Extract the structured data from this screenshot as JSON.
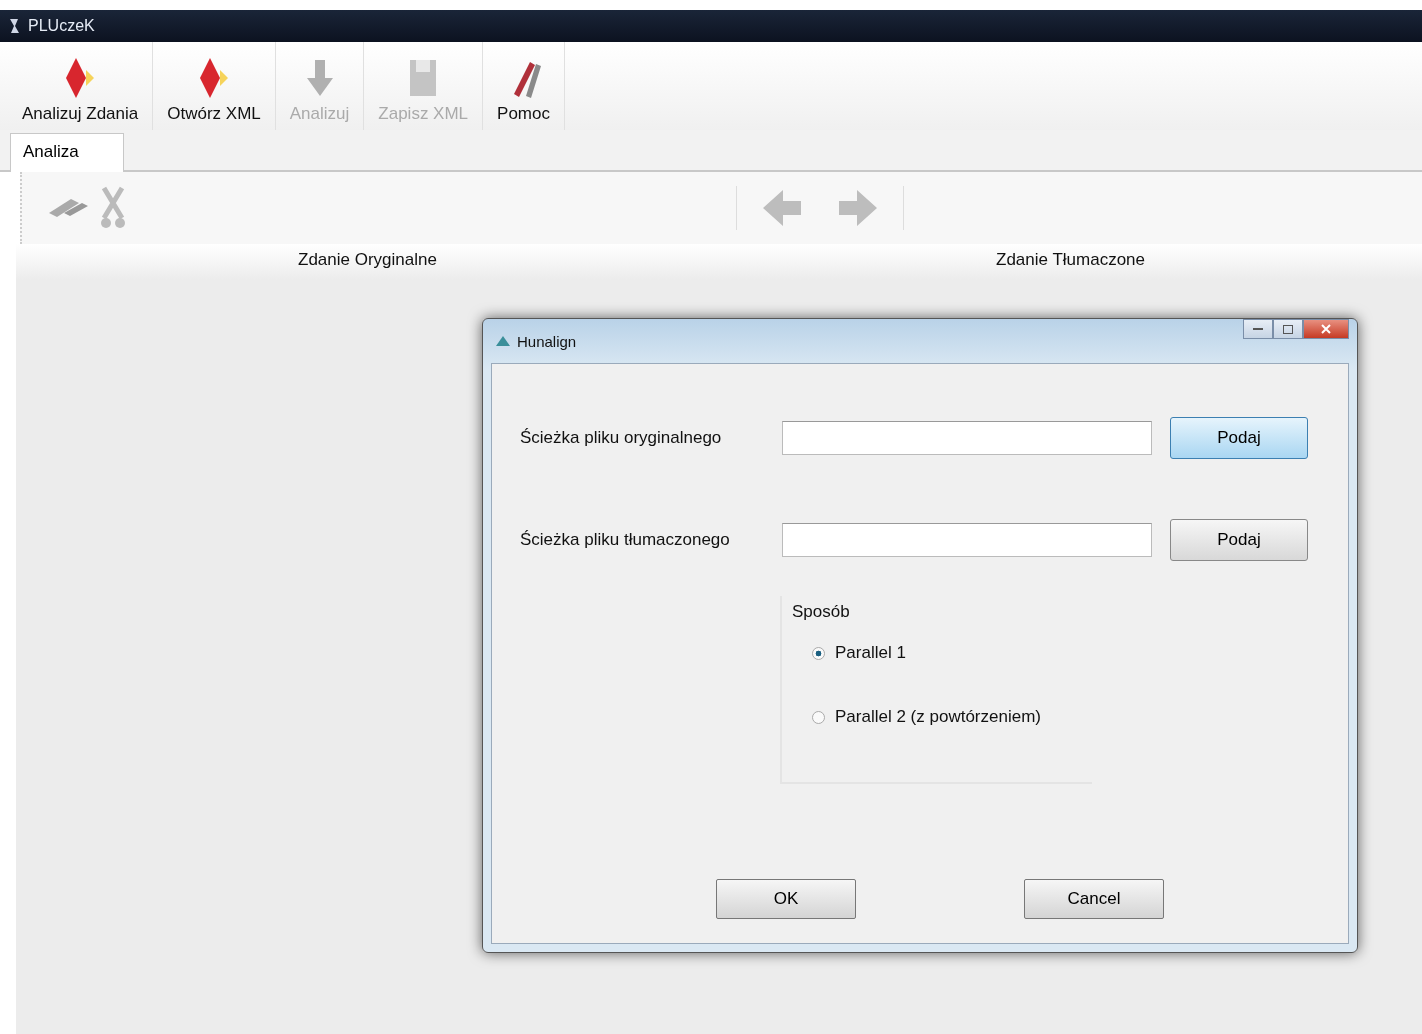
{
  "window": {
    "title": "PLUczeK"
  },
  "toolbar": [
    {
      "label": "Analizuj Zdania",
      "kind": "diamond",
      "disabled": false
    },
    {
      "label": "Otwórz XML",
      "kind": "diamond",
      "disabled": false
    },
    {
      "label": "Analizuj",
      "kind": "arrow",
      "disabled": true
    },
    {
      "label": "Zapisz XML",
      "kind": "disk",
      "disabled": true
    },
    {
      "label": "Pomoc",
      "kind": "tools",
      "disabled": false
    }
  ],
  "tabs": [
    {
      "label": "Analiza",
      "selected": true
    }
  ],
  "columns": [
    "Zdanie Oryginalne",
    "Zdanie Tłumaczone"
  ],
  "dialog": {
    "title": "Hunalign",
    "fields": [
      {
        "label": "Ścieżka pliku oryginalnego",
        "button": "Podaj",
        "highlighted": true
      },
      {
        "label": "Ścieżka pliku tłumaczonego",
        "button": "Podaj",
        "highlighted": false
      }
    ],
    "group": {
      "label": "Sposób",
      "options": [
        {
          "label": "Parallel 1",
          "selected": true
        },
        {
          "label": "Parallel 2 (z powtórzeniem)",
          "selected": false
        }
      ]
    },
    "buttons": [
      "OK",
      "Cancel"
    ]
  }
}
